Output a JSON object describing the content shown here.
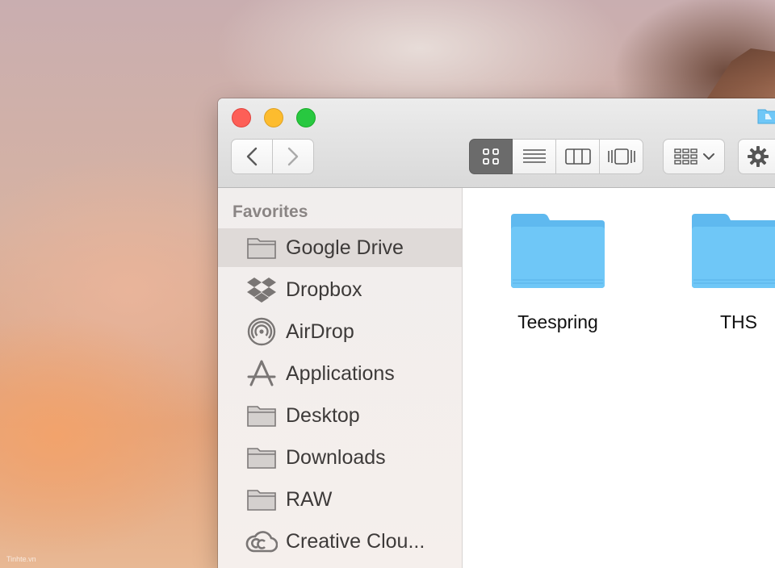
{
  "desktop": {
    "watermark": "Tinhte.vn"
  },
  "window": {
    "toolbar": {
      "back_icon": "chevron-left-icon",
      "forward_icon": "chevron-right-icon",
      "view_modes": [
        {
          "name": "icon-view",
          "active": true
        },
        {
          "name": "list-view",
          "active": false
        },
        {
          "name": "column-view",
          "active": false
        },
        {
          "name": "cover-flow-view",
          "active": false
        }
      ],
      "arrange_icon": "grid-arrange-icon",
      "action_icon": "gear-icon"
    },
    "sidebar": {
      "heading": "Favorites",
      "items": [
        {
          "label": "Google Drive",
          "icon": "folder-icon",
          "selected": true
        },
        {
          "label": "Dropbox",
          "icon": "dropbox-icon"
        },
        {
          "label": "AirDrop",
          "icon": "airdrop-icon"
        },
        {
          "label": "Applications",
          "icon": "applications-icon"
        },
        {
          "label": "Desktop",
          "icon": "folder-icon"
        },
        {
          "label": "Downloads",
          "icon": "folder-icon"
        },
        {
          "label": "RAW",
          "icon": "folder-icon"
        },
        {
          "label": "Creative Clou...",
          "icon": "creative-cloud-icon"
        }
      ]
    },
    "files": [
      {
        "name": "Teespring"
      },
      {
        "name": "THS"
      }
    ]
  },
  "colors": {
    "folder_blue": "#6fc7f7",
    "close": "#fd5f57",
    "minimize": "#fdbc2e",
    "maximize": "#28c840",
    "selection": "#dfdad8"
  }
}
